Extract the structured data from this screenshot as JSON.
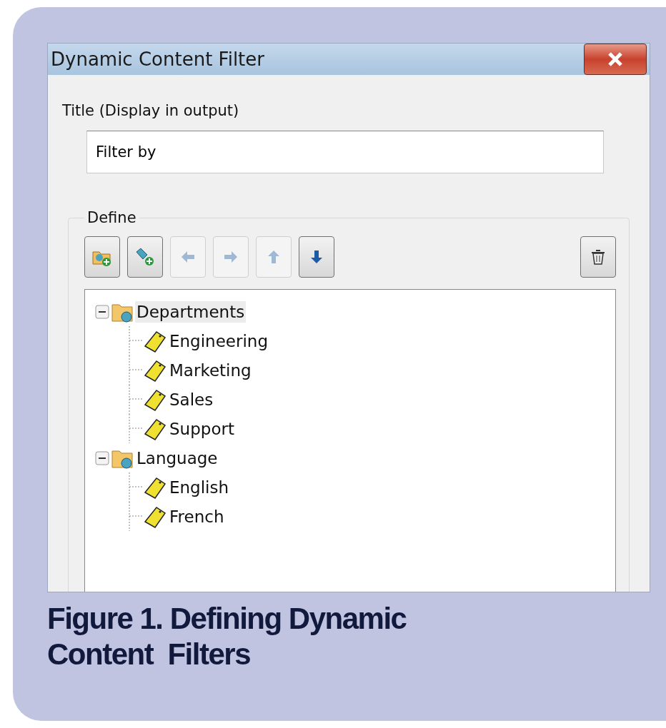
{
  "window": {
    "title": "Dynamic Content Filter"
  },
  "title_field": {
    "label": "Title (Display in output)",
    "value": "Filter by"
  },
  "define": {
    "legend": "Define",
    "toolbar": [
      {
        "kind": "add-folder",
        "disabled": false
      },
      {
        "kind": "add-tag",
        "disabled": false
      },
      {
        "kind": "left",
        "disabled": true
      },
      {
        "kind": "right",
        "disabled": true
      },
      {
        "kind": "up",
        "disabled": true
      },
      {
        "kind": "down",
        "disabled": false
      },
      {
        "kind": "delete",
        "disabled": false
      }
    ],
    "tree": [
      {
        "label": "Departments",
        "kind": "group",
        "expanded": true,
        "selected": true,
        "children": [
          {
            "label": "Engineering",
            "kind": "tag",
            "selected": false
          },
          {
            "label": "Marketing",
            "kind": "tag",
            "selected": false
          },
          {
            "label": "Sales",
            "kind": "tag",
            "selected": false
          },
          {
            "label": "Support",
            "kind": "tag",
            "selected": false
          }
        ]
      },
      {
        "label": "Language",
        "kind": "group",
        "expanded": true,
        "selected": false,
        "children": [
          {
            "label": "English",
            "kind": "tag",
            "selected": false
          },
          {
            "label": "French",
            "kind": "tag",
            "selected": false
          }
        ]
      }
    ]
  },
  "caption": [
    "Figure 1. Defining Dynamic",
    "Content  Filters"
  ]
}
